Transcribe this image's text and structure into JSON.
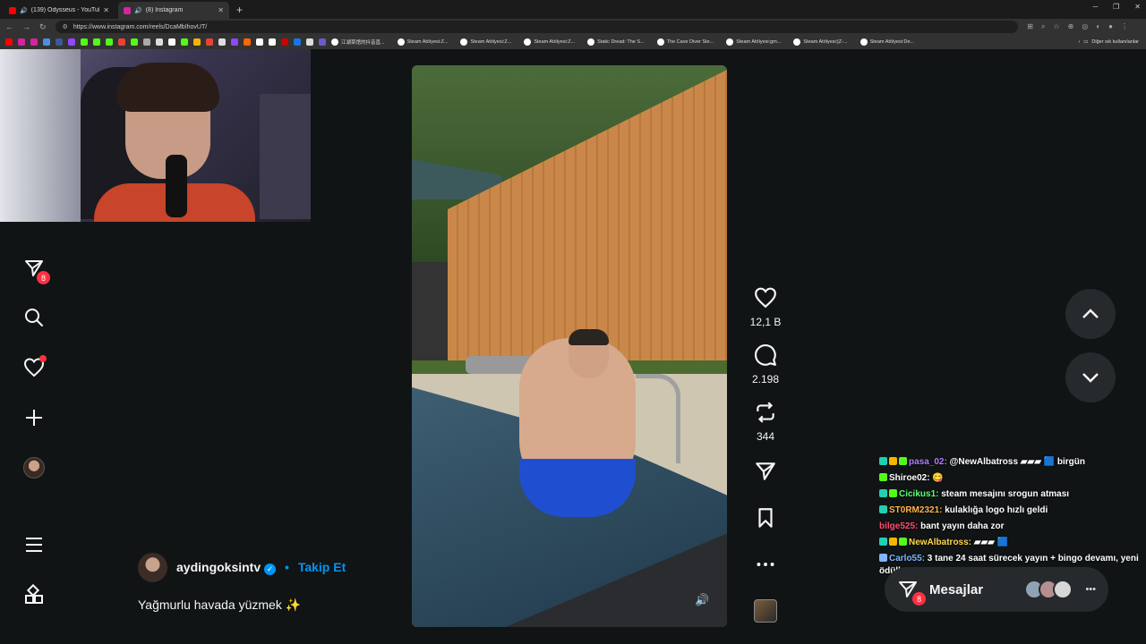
{
  "browser": {
    "tabs": [
      {
        "title": "(139) Odysseus - YouTube",
        "favicon_color": "#ff0000",
        "active": false
      },
      {
        "title": "(8) Instagram",
        "favicon_color": "#d6249f",
        "active": true
      }
    ],
    "url": "https://www.instagram.com/reels/DcaMbIhovUT/",
    "bookmarks": [
      "江湖菜馆的抖音直...",
      "Steam Atölyesi:Z...",
      "Steam Atölyesi:Z...",
      "Steam Atölyesi:Z...",
      "Static Dread: The S...",
      "The Cave Diver Ste...",
      "Steam Atölyesi:gm...",
      "Steam Atölyesi:[Z-...",
      "Steam Atölyesi:De..."
    ],
    "bookmarks_right": "Diğer sık kullanılanlar"
  },
  "sidebar": {
    "messages_badge": "8"
  },
  "reel": {
    "author": "aydingoksintv",
    "follow_label": "Takip Et",
    "separator": "•",
    "caption": "Yağmurlu havada yüzmek ✨",
    "likes": "12,1 B",
    "comments": "2.198",
    "reposts": "344"
  },
  "chat": [
    {
      "user": "pasa_02:",
      "user_color": "#b07cff",
      "text": "@NewAlbatross ▰▰▰ 🟦 birgün"
    },
    {
      "user": "Shiroe02:",
      "user_color": "#ffffff",
      "text": "😋"
    },
    {
      "user": "Cicikus1:",
      "user_color": "#5cff7a",
      "text": "steam mesajını srogun atması"
    },
    {
      "user": "ST0RM2321:",
      "user_color": "#ffb347",
      "text": "kulaklığa logo hızlı geldi"
    },
    {
      "user": "bilge525:",
      "user_color": "#ff4d6d",
      "text": "bant yayın daha zor"
    },
    {
      "user": "NewAlbatross:",
      "user_color": "#ffd84d",
      "text": "▰▰▰ 🟦"
    },
    {
      "user": "Carlo55:",
      "user_color": "#7fb6ff",
      "text": "3 tane 24 saat sürecek yayın + bingo devamı, yeni ödüller"
    }
  ],
  "messages_bar": {
    "label": "Mesajlar",
    "badge": "8"
  },
  "icons": {
    "accent": "#0095f6",
    "notification": "#ff3040"
  }
}
